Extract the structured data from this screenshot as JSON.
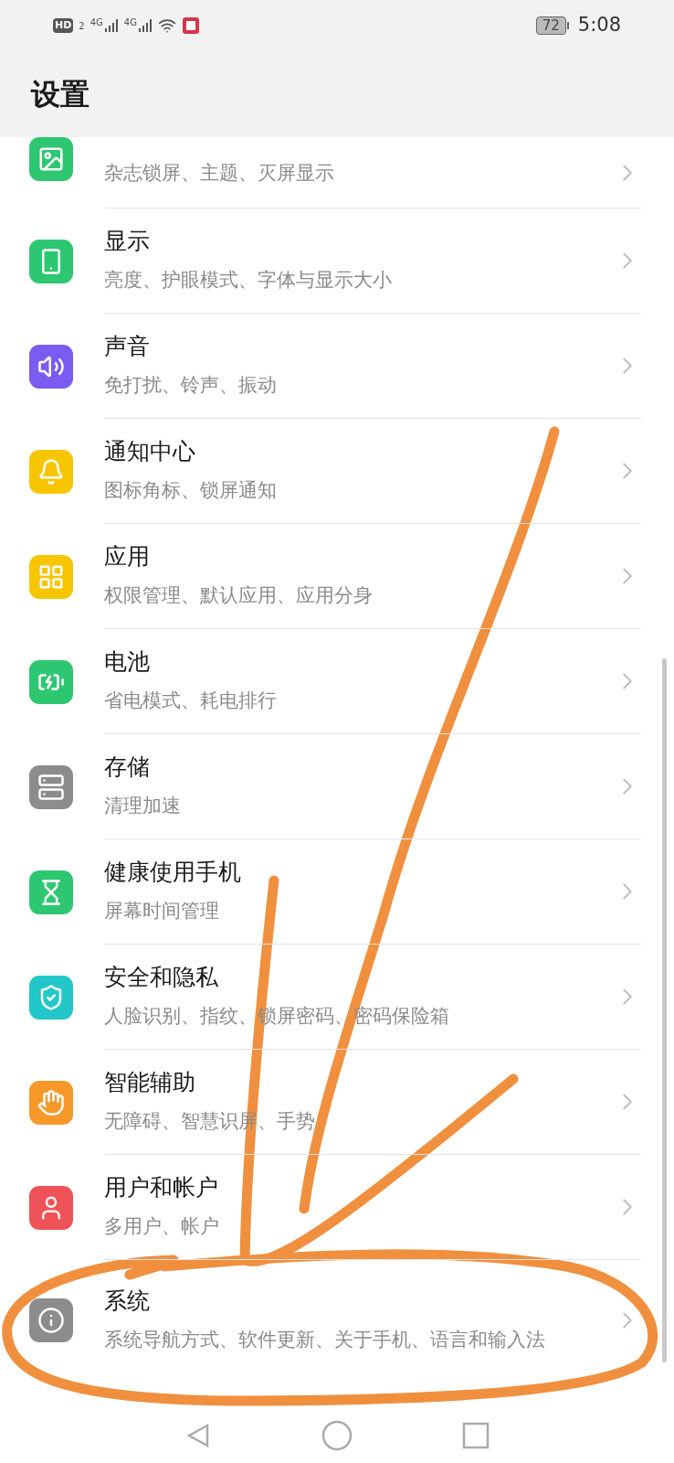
{
  "status_bar": {
    "hd": "HD",
    "sim": "2",
    "networks": [
      "4G",
      "4G"
    ],
    "battery": "72",
    "time": "5:08"
  },
  "header": {
    "title": "设置"
  },
  "items": [
    {
      "kind": "picture",
      "color": "#2ec771",
      "subtitle": "杂志锁屏、主题、灭屏显示"
    },
    {
      "kind": "phone",
      "color": "#2ec771",
      "title": "显示",
      "subtitle": "亮度、护眼模式、字体与显示大小"
    },
    {
      "kind": "speaker",
      "color": "#7b5cf0",
      "title": "声音",
      "subtitle": "免打扰、铃声、振动"
    },
    {
      "kind": "bell",
      "color": "#f7c600",
      "title": "通知中心",
      "subtitle": "图标角标、锁屏通知"
    },
    {
      "kind": "grid",
      "color": "#f7c600",
      "title": "应用",
      "subtitle": "权限管理、默认应用、应用分身"
    },
    {
      "kind": "battery",
      "color": "#2ec771",
      "title": "电池",
      "subtitle": "省电模式、耗电排行"
    },
    {
      "kind": "storage",
      "color": "#8c8c8c",
      "title": "存储",
      "subtitle": "清理加速"
    },
    {
      "kind": "hourglass",
      "color": "#2ec771",
      "title": "健康使用手机",
      "subtitle": "屏幕时间管理"
    },
    {
      "kind": "shield",
      "color": "#22c7c9",
      "title": "安全和隐私",
      "subtitle": "人脸识别、指纹、锁屏密码、密码保险箱"
    },
    {
      "kind": "hand",
      "color": "#f7982a",
      "title": "智能辅助",
      "subtitle": "无障碍、智慧识屏、手势"
    },
    {
      "kind": "user",
      "color": "#ef5357",
      "title": "用户和帐户",
      "subtitle": "多用户、帐户"
    },
    {
      "kind": "info",
      "color": "#8c8c8c",
      "title": "系统",
      "subtitle": "系统导航方式、软件更新、关于手机、语言和输入法"
    }
  ]
}
